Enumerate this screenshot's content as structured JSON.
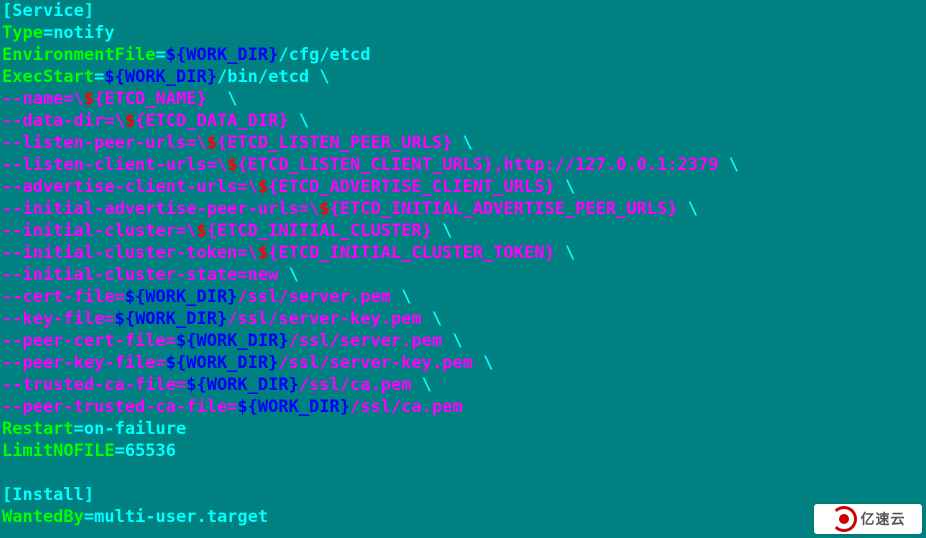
{
  "lines": [
    [
      [
        "cyan",
        "[Service]"
      ]
    ],
    [
      [
        "green",
        "Type"
      ],
      [
        "cyan",
        "=notify"
      ]
    ],
    [
      [
        "green",
        "EnvironmentFile"
      ],
      [
        "cyan",
        "="
      ],
      [
        "blue",
        "${WORK_DIR}"
      ],
      [
        "cyan",
        "/cfg/etcd"
      ]
    ],
    [
      [
        "green",
        "ExecStart"
      ],
      [
        "cyan",
        "="
      ],
      [
        "blue",
        "${WORK_DIR}"
      ],
      [
        "cyan",
        "/bin/etcd \\"
      ]
    ],
    [
      [
        "magenta",
        "--name=\\"
      ],
      [
        "red",
        "$"
      ],
      [
        "magenta",
        "{ETCD_NAME} "
      ],
      [
        "cyan",
        " \\"
      ]
    ],
    [
      [
        "magenta",
        "--data-dir=\\"
      ],
      [
        "red",
        "$"
      ],
      [
        "magenta",
        "{ETCD_DATA_DIR}"
      ],
      [
        "cyan",
        " \\"
      ]
    ],
    [
      [
        "magenta",
        "--listen-peer-urls=\\"
      ],
      [
        "red",
        "$"
      ],
      [
        "magenta",
        "{ETCD_LISTEN_PEER_URLS}"
      ],
      [
        "cyan",
        " \\"
      ]
    ],
    [
      [
        "magenta",
        "--listen-client-urls=\\"
      ],
      [
        "red",
        "$"
      ],
      [
        "magenta",
        "{ETCD_LISTEN_CLIENT_URLS},http://127.0.0.1:2379"
      ],
      [
        "cyan",
        " \\"
      ]
    ],
    [
      [
        "magenta",
        "--advertise-client-urls=\\"
      ],
      [
        "red",
        "$"
      ],
      [
        "magenta",
        "{ETCD_ADVERTISE_CLIENT_URLS}"
      ],
      [
        "cyan",
        " \\"
      ]
    ],
    [
      [
        "magenta",
        "--initial-advertise-peer-urls=\\"
      ],
      [
        "red",
        "$"
      ],
      [
        "magenta",
        "{ETCD_INITIAL_ADVERTISE_PEER_URLS}"
      ],
      [
        "cyan",
        " \\"
      ]
    ],
    [
      [
        "magenta",
        "--initial-cluster=\\"
      ],
      [
        "red",
        "$"
      ],
      [
        "magenta",
        "{ETCD_INITIAL_CLUSTER}"
      ],
      [
        "cyan",
        " \\"
      ]
    ],
    [
      [
        "magenta",
        "--initial-cluster-token=\\"
      ],
      [
        "red",
        "$"
      ],
      [
        "magenta",
        "{ETCD_INITIAL_CLUSTER_TOKEN}"
      ],
      [
        "cyan",
        " \\"
      ]
    ],
    [
      [
        "magenta",
        "--initial-cluster-state=new"
      ],
      [
        "cyan",
        " \\"
      ]
    ],
    [
      [
        "magenta",
        "--cert-file="
      ],
      [
        "blue",
        "${WORK_DIR}"
      ],
      [
        "magenta",
        "/ssl/server.pem"
      ],
      [
        "cyan",
        " \\"
      ]
    ],
    [
      [
        "magenta",
        "--key-file="
      ],
      [
        "blue",
        "${WORK_DIR}"
      ],
      [
        "magenta",
        "/ssl/server-key.pem"
      ],
      [
        "cyan",
        " \\"
      ]
    ],
    [
      [
        "magenta",
        "--peer-cert-file="
      ],
      [
        "blue",
        "${WORK_DIR}"
      ],
      [
        "magenta",
        "/ssl/server.pem"
      ],
      [
        "cyan",
        " \\"
      ]
    ],
    [
      [
        "magenta",
        "--peer-key-file="
      ],
      [
        "blue",
        "${WORK_DIR}"
      ],
      [
        "magenta",
        "/ssl/server-key.pem"
      ],
      [
        "cyan",
        " \\"
      ]
    ],
    [
      [
        "magenta",
        "--trusted-ca-file="
      ],
      [
        "blue",
        "${WORK_DIR}"
      ],
      [
        "magenta",
        "/ssl/ca.pem"
      ],
      [
        "cyan",
        " \\"
      ]
    ],
    [
      [
        "magenta",
        "--peer-trusted-ca-file="
      ],
      [
        "blue",
        "${WORK_DIR}"
      ],
      [
        "magenta",
        "/ssl/ca.pem"
      ]
    ],
    [
      [
        "green",
        "Restart"
      ],
      [
        "cyan",
        "=on-failure"
      ]
    ],
    [
      [
        "green",
        "LimitNOFILE"
      ],
      [
        "cyan",
        "=65536"
      ]
    ],
    [
      [
        "cyan",
        ""
      ]
    ],
    [
      [
        "cyan",
        "[Install]"
      ]
    ],
    [
      [
        "green",
        "WantedBy"
      ],
      [
        "cyan",
        "=multi-user.target"
      ]
    ]
  ],
  "watermark": {
    "text": "亿速云"
  }
}
